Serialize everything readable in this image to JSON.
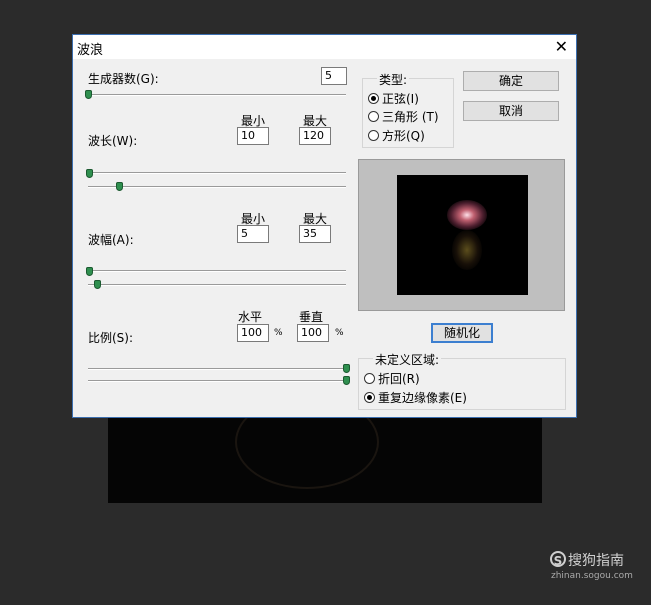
{
  "dialog": {
    "title": "波浪",
    "close_glyph": "✕",
    "generators": {
      "label": "生成器数(G):",
      "value": "5"
    },
    "wavelength": {
      "label": "波长(W):",
      "min_label": "最小",
      "max_label": "最大",
      "min": "10",
      "max": "120"
    },
    "amplitude": {
      "label": "波幅(A):",
      "min_label": "最小",
      "max_label": "最大",
      "min": "5",
      "max": "35"
    },
    "scale": {
      "label": "比例(S):",
      "h_label": "水平",
      "v_label": "垂直",
      "h": "100",
      "v": "100",
      "unit": "%"
    },
    "type": {
      "legend": "类型:",
      "options": [
        {
          "label": "正弦(I)",
          "checked": true
        },
        {
          "label": "三角形 (T)",
          "checked": false
        },
        {
          "label": "方形(Q)",
          "checked": false
        }
      ]
    },
    "ok_label": "确定",
    "cancel_label": "取消",
    "randomize_label": "随机化",
    "undefined_area": {
      "legend": "未定义区域:",
      "options": [
        {
          "label": "折回(R)",
          "checked": false
        },
        {
          "label": "重复边缘像素(E)",
          "checked": true
        }
      ]
    }
  },
  "watermark": {
    "icon_glyph": "S",
    "text": "搜狗指南",
    "url": "zhinan.sogou.com"
  }
}
